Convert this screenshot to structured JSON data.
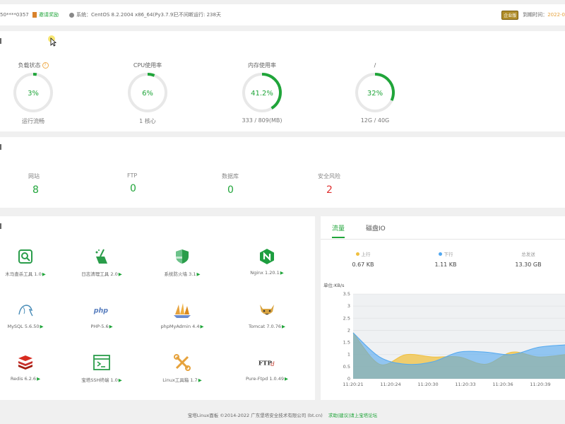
{
  "topbar": {
    "user": "50****0357",
    "rewards": "邀请奖励",
    "system_label": "系统：",
    "system": "CentOS 8.2.2004 x86_64(Py3.7.9)",
    "uptime": "已不间断运行: 238天",
    "vip": "企业版",
    "expire_label": "到期时间：",
    "expire_date": "2022-0"
  },
  "status": {
    "gauges": [
      {
        "title": "负载状态",
        "value": "3%",
        "percent": 3,
        "sub": "运行流畅",
        "has_help": true
      },
      {
        "title": "CPU使用率",
        "value": "6%",
        "percent": 6,
        "sub": "1 核心",
        "has_help": false
      },
      {
        "title": "内存使用率",
        "value": "41.2%",
        "percent": 41.2,
        "sub": "333 / 809(MB)",
        "has_help": false
      },
      {
        "title": "/",
        "value": "32%",
        "percent": 32,
        "sub": "12G / 40G",
        "has_help": false
      }
    ]
  },
  "stats": [
    {
      "label": "网站",
      "value": "8"
    },
    {
      "label": "FTP",
      "value": "0"
    },
    {
      "label": "数据库",
      "value": "0"
    },
    {
      "label": "安全风险",
      "value": "2"
    }
  ],
  "software": [
    {
      "name": "木马查杀工具 1.0",
      "icon": "trojan-scan-icon"
    },
    {
      "name": "日志清理工具 2.0",
      "icon": "log-clean-icon"
    },
    {
      "name": "系统防火墙 3.1",
      "icon": "firewall-icon"
    },
    {
      "name": "Nginx 1.20.1",
      "icon": "nginx-icon"
    },
    {
      "name": "MySQL 5.6.50",
      "icon": "mysql-icon"
    },
    {
      "name": "PHP-5.6",
      "icon": "php-icon"
    },
    {
      "name": "phpMyAdmin 4.4",
      "icon": "phpmyadmin-icon"
    },
    {
      "name": "Tomcat 7.0.76",
      "icon": "tomcat-icon"
    },
    {
      "name": "Redis 6.2.6",
      "icon": "redis-icon"
    },
    {
      "name": "宝塔SSH终端 1.0",
      "icon": "ssh-terminal-icon"
    },
    {
      "name": "Linux工具箱 1.7",
      "icon": "toolbox-icon"
    },
    {
      "name": "Pure-Ftpd 1.0.49",
      "icon": "ftpd-icon"
    }
  ],
  "traffic": {
    "tabs": [
      "流量",
      "磁盘IO"
    ],
    "up_label": "上行",
    "up_value": "0.67 KB",
    "down_label": "下行",
    "down_value": "1.11 KB",
    "total_label": "总发送",
    "total_value": "13.30 GB"
  },
  "chart_data": {
    "type": "area",
    "ylabel": "单位:KB/s",
    "ylim": [
      0,
      3.5
    ],
    "yticks": [
      "3.5",
      "3",
      "2.5",
      "2",
      "1.5",
      "1",
      "0.5",
      "0"
    ],
    "x": [
      "11:20:21",
      "11:20:24",
      "11:20:30",
      "11:20:33",
      "11:20:36",
      "11:20:39"
    ],
    "series": [
      {
        "name": "上行",
        "color": "#f0c040",
        "values": [
          1.9,
          0.6,
          1.0,
          0.9,
          0.9,
          0.6,
          1.1,
          0.9,
          1.0
        ]
      },
      {
        "name": "下行",
        "color": "#52a8f0",
        "values": [
          1.9,
          0.9,
          0.6,
          0.7,
          1.1,
          1.1,
          1.0,
          1.3,
          1.4
        ]
      }
    ],
    "grid": true
  },
  "footer": {
    "copyright": "宝塔Linux面板 ©2014-2022 广东堡塔安全技术有限公司 (bt.cn)",
    "link": "求助|建议|请上宝塔论坛"
  },
  "colors": {
    "accent": "#20a53a",
    "risk": "#e03030",
    "up": "#f0c040",
    "down": "#52a8f0"
  }
}
